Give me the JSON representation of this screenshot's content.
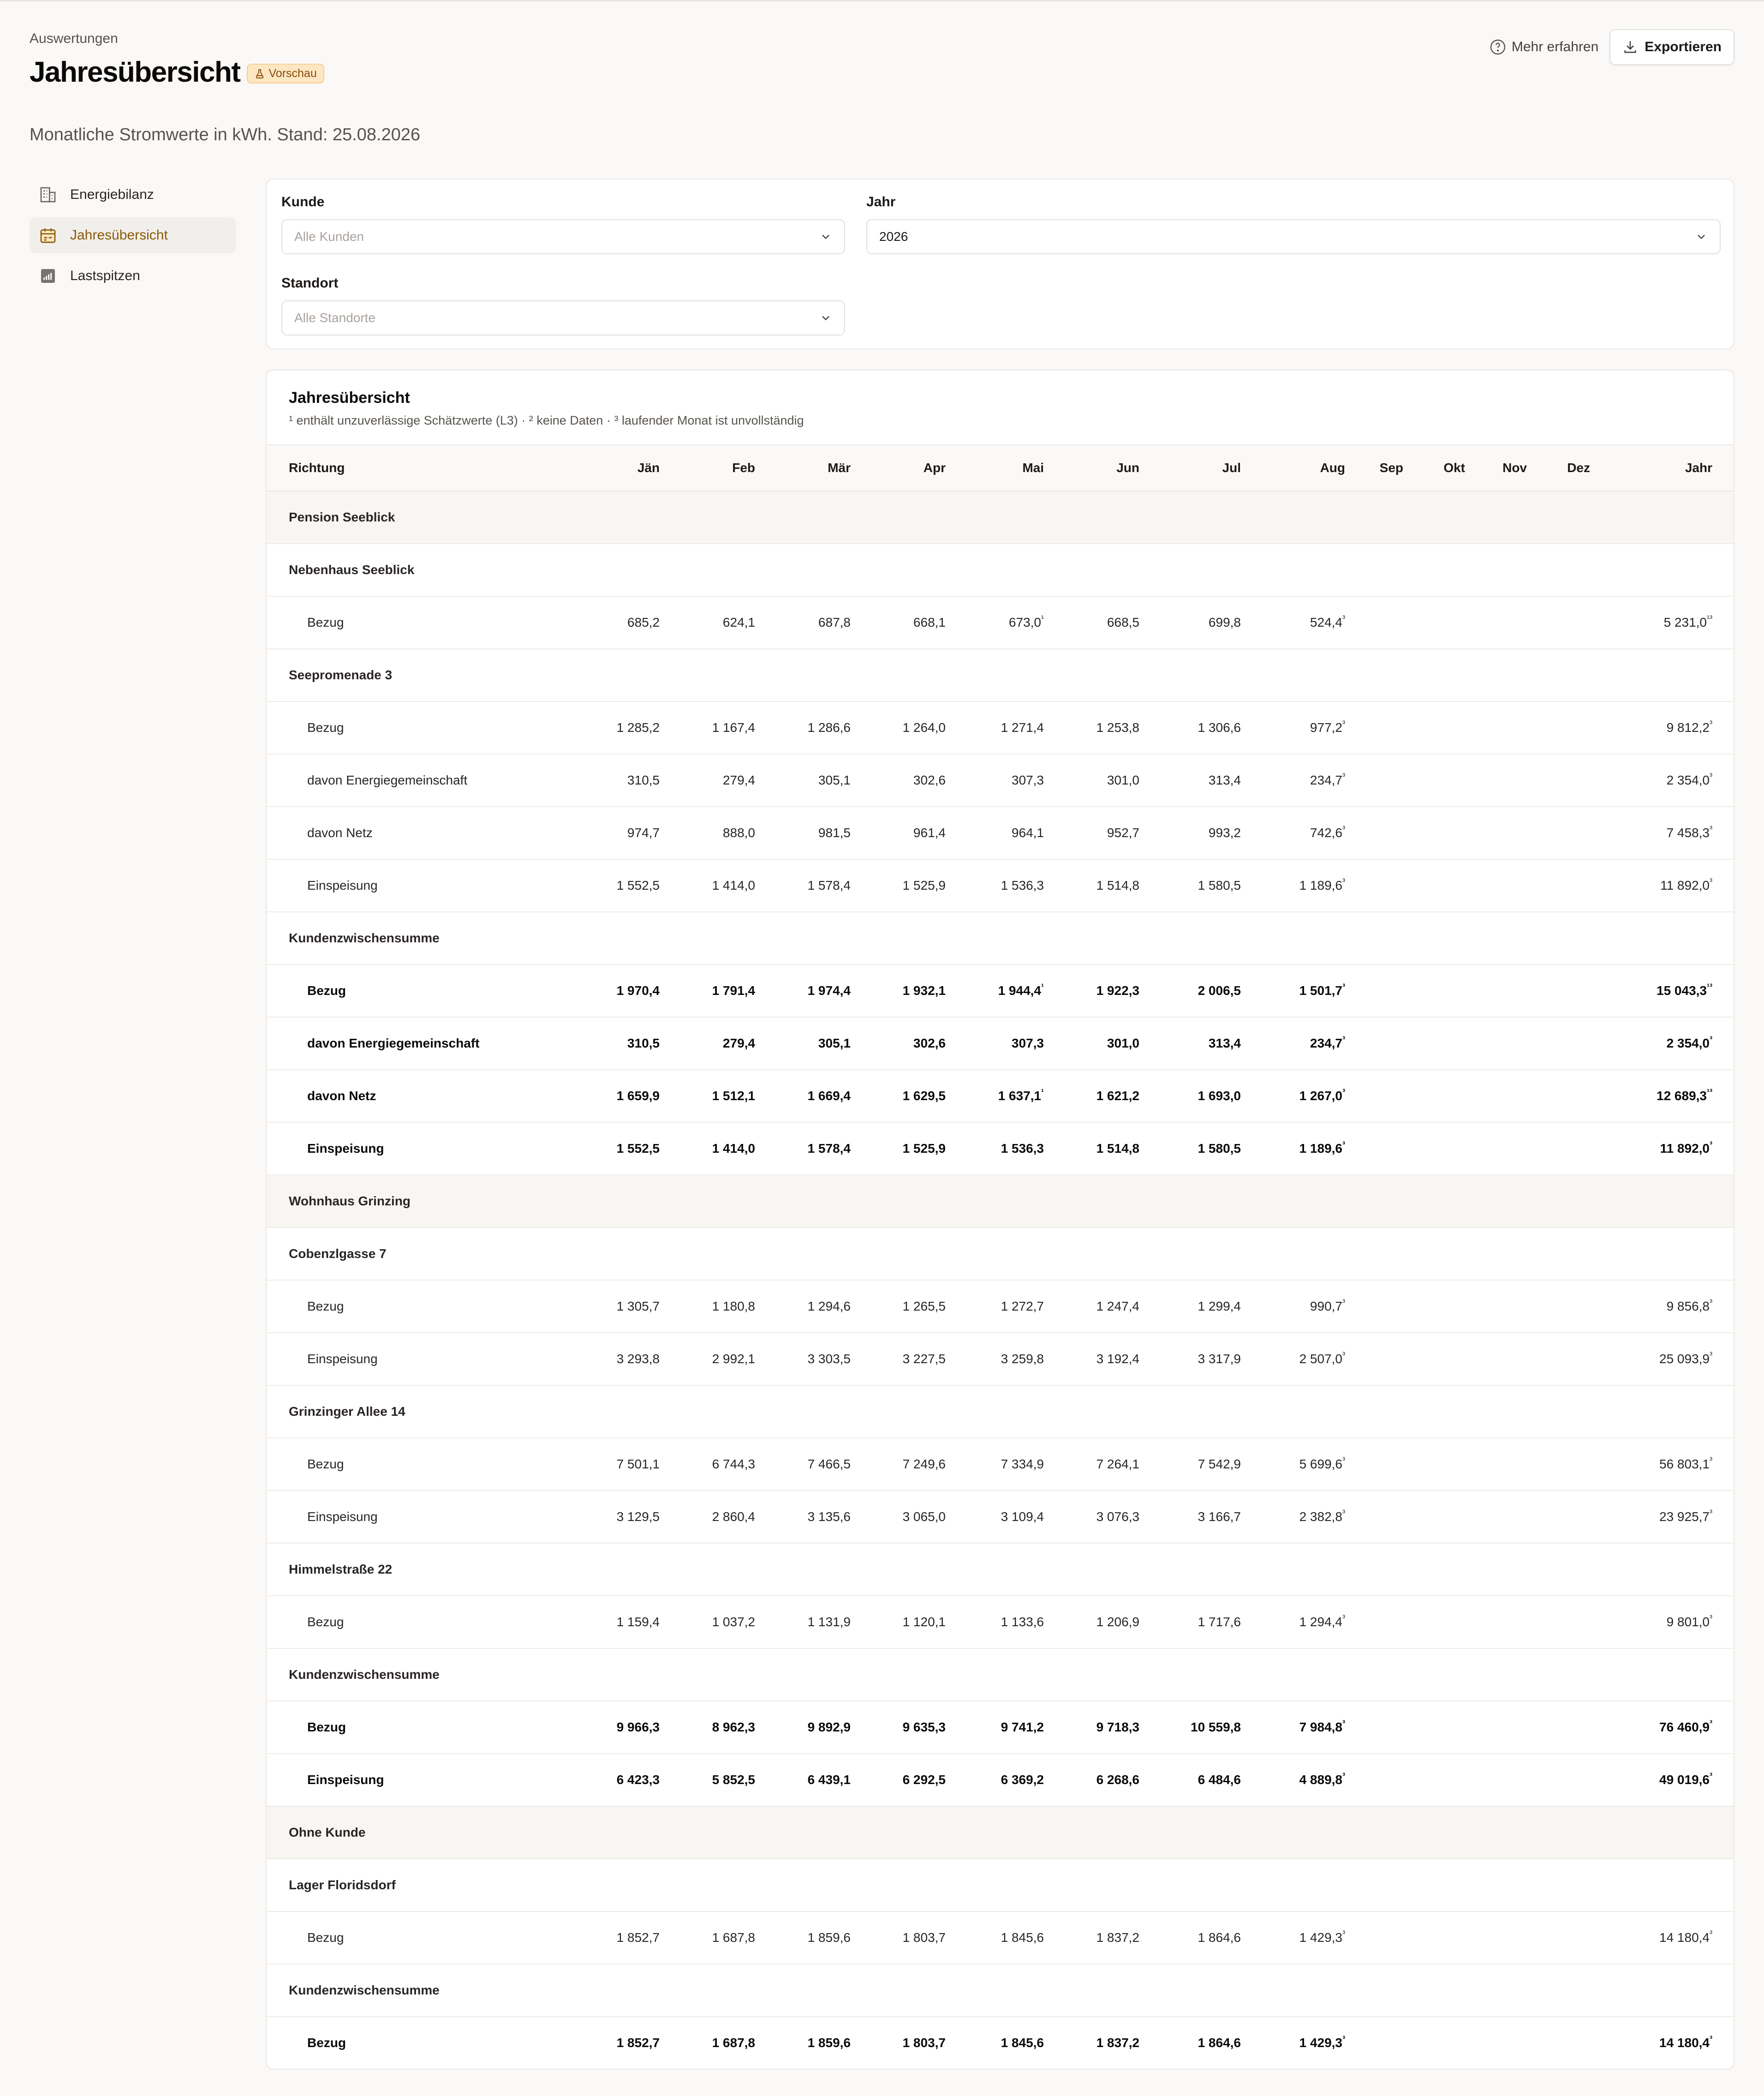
{
  "header": {
    "breadcrumb": "Auswertungen",
    "title": "Jahresübersicht",
    "badge": "Vorschau",
    "learn_more": "Mehr erfahren",
    "export": "Exportieren",
    "subtitle": "Monatliche Stromwerte in kWh. Stand: 25.08.2026"
  },
  "sidebar": {
    "items": [
      {
        "label": "Energiebilanz",
        "icon": "building-icon"
      },
      {
        "label": "Jahresübersicht",
        "icon": "calendar-icon",
        "active": true
      },
      {
        "label": "Lastspitzen",
        "icon": "bar-chart-icon"
      }
    ]
  },
  "filters": {
    "customer": {
      "label": "Kunde",
      "placeholder": "Alle Kunden"
    },
    "year": {
      "label": "Jahr",
      "value": "2026"
    },
    "location": {
      "label": "Standort",
      "placeholder": "Alle Standorte"
    }
  },
  "table": {
    "title": "Jahresübersicht",
    "note": "¹ enthält unzuverlässige Schätzwerte (L3) · ² keine Daten · ³ laufender Monat ist unvollständig",
    "columns": [
      "Richtung",
      "Jän",
      "Feb",
      "Mär",
      "Apr",
      "Mai",
      "Jun",
      "Jul",
      "Aug",
      "Sep",
      "Okt",
      "Nov",
      "Dez",
      "Jahr"
    ],
    "rows": [
      {
        "type": "customer",
        "label": "Pension Seeblick"
      },
      {
        "type": "site",
        "label": "Nebenhaus Seeblick"
      },
      {
        "type": "data",
        "label": "Bezug",
        "values": [
          "685,2",
          "624,1",
          "687,8",
          "668,1",
          "673,0|1",
          "668,5",
          "699,8",
          "524,4|3",
          "",
          "",
          "",
          "",
          "5 231,0|13"
        ]
      },
      {
        "type": "site",
        "label": "Seepromenade 3"
      },
      {
        "type": "data",
        "label": "Bezug",
        "values": [
          "1 285,2",
          "1 167,4",
          "1 286,6",
          "1 264,0",
          "1 271,4",
          "1 253,8",
          "1 306,6",
          "977,2|3",
          "",
          "",
          "",
          "",
          "9 812,2|3"
        ]
      },
      {
        "type": "data",
        "label": "davon Energiegemeinschaft",
        "values": [
          "310,5",
          "279,4",
          "305,1",
          "302,6",
          "307,3",
          "301,0",
          "313,4",
          "234,7|3",
          "",
          "",
          "",
          "",
          "2 354,0|3"
        ]
      },
      {
        "type": "data",
        "label": "davon Netz",
        "values": [
          "974,7",
          "888,0",
          "981,5",
          "961,4",
          "964,1",
          "952,7",
          "993,2",
          "742,6|3",
          "",
          "",
          "",
          "",
          "7 458,3|3"
        ]
      },
      {
        "type": "data",
        "label": "Einspeisung",
        "values": [
          "1 552,5",
          "1 414,0",
          "1 578,4",
          "1 525,9",
          "1 536,3",
          "1 514,8",
          "1 580,5",
          "1 189,6|3",
          "",
          "",
          "",
          "",
          "11 892,0|3"
        ]
      },
      {
        "type": "subtotal",
        "label": "Kundenzwischensumme"
      },
      {
        "type": "bold",
        "label": "Bezug",
        "values": [
          "1 970,4",
          "1 791,4",
          "1 974,4",
          "1 932,1",
          "1 944,4|1",
          "1 922,3",
          "2 006,5",
          "1 501,7|3",
          "",
          "",
          "",
          "",
          "15 043,3|13"
        ]
      },
      {
        "type": "bold",
        "label": "davon Energiegemeinschaft",
        "values": [
          "310,5",
          "279,4",
          "305,1",
          "302,6",
          "307,3",
          "301,0",
          "313,4",
          "234,7|3",
          "",
          "",
          "",
          "",
          "2 354,0|3"
        ]
      },
      {
        "type": "bold",
        "label": "davon Netz",
        "values": [
          "1 659,9",
          "1 512,1",
          "1 669,4",
          "1 629,5",
          "1 637,1|1",
          "1 621,2",
          "1 693,0",
          "1 267,0|3",
          "",
          "",
          "",
          "",
          "12 689,3|13"
        ]
      },
      {
        "type": "bold",
        "label": "Einspeisung",
        "values": [
          "1 552,5",
          "1 414,0",
          "1 578,4",
          "1 525,9",
          "1 536,3",
          "1 514,8",
          "1 580,5",
          "1 189,6|3",
          "",
          "",
          "",
          "",
          "11 892,0|3"
        ]
      },
      {
        "type": "customer",
        "label": "Wohnhaus Grinzing"
      },
      {
        "type": "site",
        "label": "Cobenzlgasse 7"
      },
      {
        "type": "data",
        "label": "Bezug",
        "values": [
          "1 305,7",
          "1 180,8",
          "1 294,6",
          "1 265,5",
          "1 272,7",
          "1 247,4",
          "1 299,4",
          "990,7|3",
          "",
          "",
          "",
          "",
          "9 856,8|3"
        ]
      },
      {
        "type": "data",
        "label": "Einspeisung",
        "values": [
          "3 293,8",
          "2 992,1",
          "3 303,5",
          "3 227,5",
          "3 259,8",
          "3 192,4",
          "3 317,9",
          "2 507,0|3",
          "",
          "",
          "",
          "",
          "25 093,9|3"
        ]
      },
      {
        "type": "site",
        "label": "Grinzinger Allee 14"
      },
      {
        "type": "data",
        "label": "Bezug",
        "values": [
          "7 501,1",
          "6 744,3",
          "7 466,5",
          "7 249,6",
          "7 334,9",
          "7 264,1",
          "7 542,9",
          "5 699,6|3",
          "",
          "",
          "",
          "",
          "56 803,1|3"
        ]
      },
      {
        "type": "data",
        "label": "Einspeisung",
        "values": [
          "3 129,5",
          "2 860,4",
          "3 135,6",
          "3 065,0",
          "3 109,4",
          "3 076,3",
          "3 166,7",
          "2 382,8|3",
          "",
          "",
          "",
          "",
          "23 925,7|3"
        ]
      },
      {
        "type": "site",
        "label": "Himmelstraße 22"
      },
      {
        "type": "data",
        "label": "Bezug",
        "values": [
          "1 159,4",
          "1 037,2",
          "1 131,9",
          "1 120,1",
          "1 133,6",
          "1 206,9",
          "1 717,6",
          "1 294,4|3",
          "",
          "",
          "",
          "",
          "9 801,0|3"
        ]
      },
      {
        "type": "subtotal",
        "label": "Kundenzwischensumme"
      },
      {
        "type": "bold",
        "label": "Bezug",
        "values": [
          "9 966,3",
          "8 962,3",
          "9 892,9",
          "9 635,3",
          "9 741,2",
          "9 718,3",
          "10 559,8",
          "7 984,8|3",
          "",
          "",
          "",
          "",
          "76 460,9|3"
        ]
      },
      {
        "type": "bold",
        "label": "Einspeisung",
        "values": [
          "6 423,3",
          "5 852,5",
          "6 439,1",
          "6 292,5",
          "6 369,2",
          "6 268,6",
          "6 484,6",
          "4 889,8|3",
          "",
          "",
          "",
          "",
          "49 019,6|3"
        ]
      },
      {
        "type": "customer",
        "label": "Ohne Kunde"
      },
      {
        "type": "site",
        "label": "Lager Floridsdorf"
      },
      {
        "type": "data",
        "label": "Bezug",
        "values": [
          "1 852,7",
          "1 687,8",
          "1 859,6",
          "1 803,7",
          "1 845,6",
          "1 837,2",
          "1 864,6",
          "1 429,3|3",
          "",
          "",
          "",
          "",
          "14 180,4|3"
        ]
      },
      {
        "type": "subtotal",
        "label": "Kundenzwischensumme"
      },
      {
        "type": "bold",
        "label": "Bezug",
        "values": [
          "1 852,7",
          "1 687,8",
          "1 859,6",
          "1 803,7",
          "1 845,6",
          "1 837,2",
          "1 864,6",
          "1 429,3|3",
          "",
          "",
          "",
          "",
          "14 180,4|3"
        ]
      }
    ]
  },
  "colors": {
    "accent": "#8a5a08",
    "badge_bg": "#fde7c3",
    "background": "#faf9f7"
  }
}
